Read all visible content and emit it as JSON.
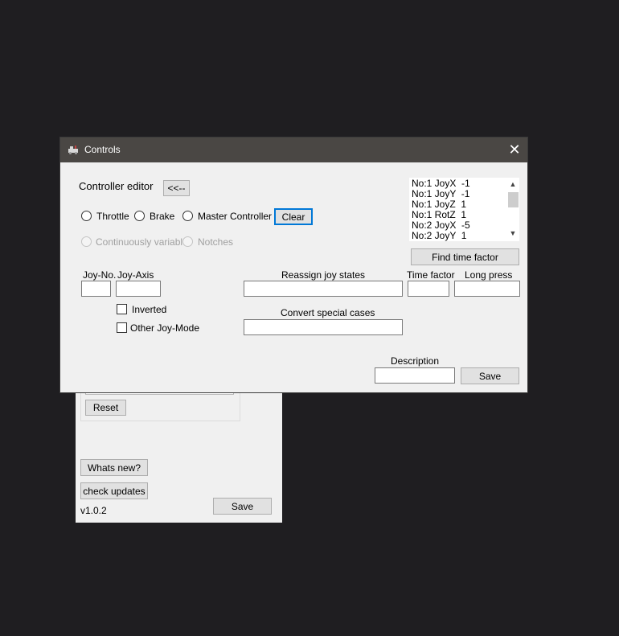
{
  "background_window": {
    "reset_label": "Reset",
    "whats_new_label": "Whats new?",
    "check_updates_label": "check updates",
    "version": "v1.0.2",
    "save_label": "Save"
  },
  "dialog": {
    "title": "Controls",
    "close_symbol": "✕",
    "controller_editor_label": "Controller editor",
    "back_button_label": "<<--",
    "radios": {
      "throttle": "Throttle",
      "brake": "Brake",
      "master_controller": "Master Controller"
    },
    "clear_label": "Clear",
    "mode_radios": {
      "continuously_variable": "Continuously variable",
      "notches": "Notches"
    },
    "joy_no_label": "Joy-No.",
    "joy_axis_label": "Joy-Axis",
    "joy_no_value": "",
    "joy_axis_value": "",
    "inverted_label": "Inverted",
    "other_joy_mode_label": "Other Joy-Mode",
    "reassign_label": "Reassign joy states",
    "reassign_value": "",
    "time_factor_label": "Time factor",
    "time_factor_value": "",
    "long_press_label": "Long press",
    "long_press_value": "",
    "convert_label": "Convert special cases",
    "convert_value": "",
    "find_time_factor_label": "Find time factor",
    "description_label": "Description",
    "description_value": "",
    "save_label": "Save",
    "list_items": [
      "No:1 JoyX  -1",
      "No:1 JoyY  -1",
      "No:1 JoyZ  1",
      "No:1 RotZ  1",
      "No:2 JoyX  -5",
      "No:2 JoyY  1"
    ]
  }
}
